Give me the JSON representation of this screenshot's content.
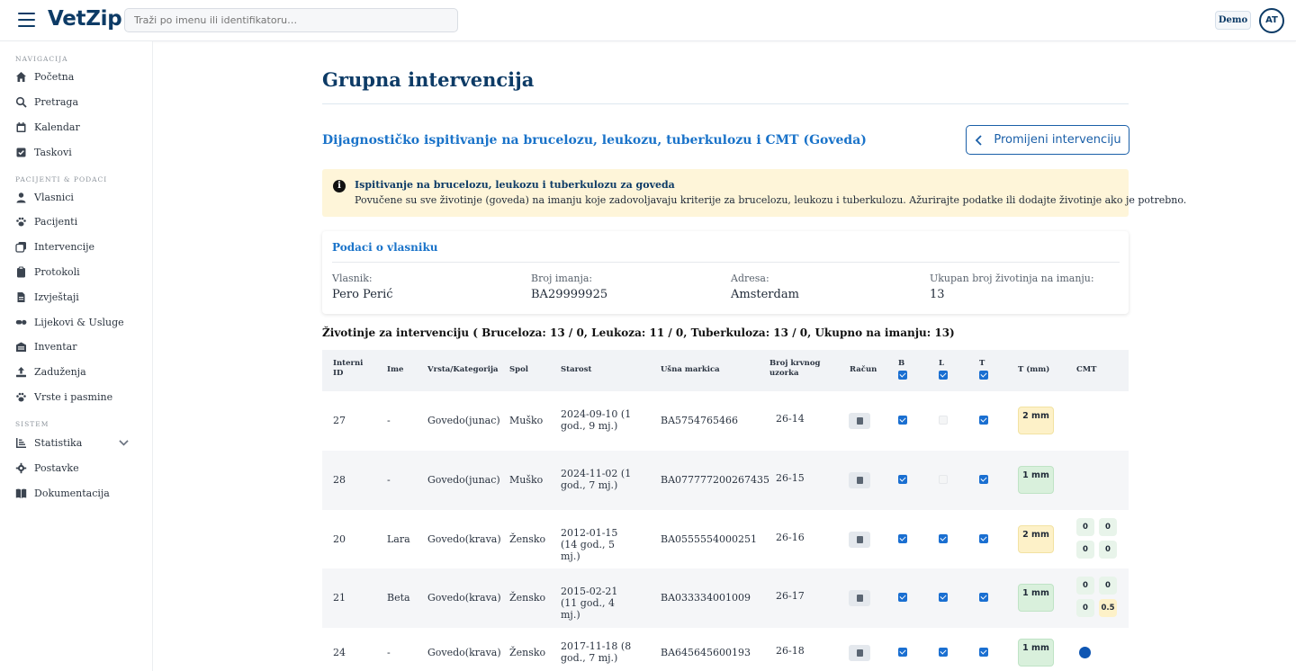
{
  "header": {
    "logo": "VetZip",
    "search_placeholder": "Traži po imenu ili identifikatoru…",
    "demo_badge": "Demo",
    "avatar_initials": "AT"
  },
  "sidebar": {
    "sections": [
      "NAVIGACIJA",
      "PACIJENTI & PODACI",
      "SISTEM"
    ],
    "nav": [
      {
        "label": "Početna",
        "icon": "home-icon"
      },
      {
        "label": "Pretraga",
        "icon": "search-icon"
      },
      {
        "label": "Kalendar",
        "icon": "calendar-icon"
      },
      {
        "label": "Taskovi",
        "icon": "task-icon"
      }
    ],
    "data": [
      {
        "label": "Vlasnici",
        "icon": "person-icon"
      },
      {
        "label": "Pacijenti",
        "icon": "paw-icon"
      },
      {
        "label": "Intervencije",
        "icon": "intervention-icon"
      },
      {
        "label": "Protokoli",
        "icon": "clipboard-icon"
      },
      {
        "label": "Izvještaji",
        "icon": "report-icon"
      },
      {
        "label": "Lijekovi & Usluge",
        "icon": "pills-icon"
      },
      {
        "label": "Inventar",
        "icon": "inventory-icon"
      },
      {
        "label": "Zaduženja",
        "icon": "upload-icon"
      },
      {
        "label": "Vrste i pasmine",
        "icon": "paw-icon"
      }
    ],
    "system": [
      {
        "label": "Statistika",
        "icon": "chart-icon"
      },
      {
        "label": "Postavke",
        "icon": "gear-icon"
      },
      {
        "label": "Dokumentacija",
        "icon": "book-icon"
      }
    ]
  },
  "main": {
    "title": "Grupna intervencija",
    "subtitle": "Dijagnostičko ispitivanje na brucelozu, leukozu, tuberkulozu i CMT (Goveda)",
    "change_button": "Promijeni intervenciju",
    "alert": {
      "title": "Ispitivanje na brucelozu, leukozu i tuberkulozu za goveda",
      "text": "Povučene su sve životinje (goveda) na imanju koje zadovoljavaju kriterije za brucelozu, leukozu i tuberkulozu. Ažurirajte podatke ili dodajte životinje ako je potrebno."
    },
    "owner": {
      "title": "Podaci o vlasniku",
      "fields": [
        {
          "label": "Vlasnik:",
          "value": "Pero Perić"
        },
        {
          "label": "Broj imanja:",
          "value": "BA29999925"
        },
        {
          "label": "Adresa:",
          "value": "Amsterdam"
        },
        {
          "label": "Ukupan broj životinja na imanju:",
          "value": "13"
        }
      ]
    },
    "animals_heading": "Životinje za intervenciju ( Bruceloza: 13 / 0, Leukoza: 11 / 0, Tuberkuloza: 13 / 0, Ukupno na imanju: 13)",
    "table": {
      "columns": [
        "Interni ID",
        "Ime",
        "Vrsta/Kategorija",
        "Spol",
        "Starost",
        "Ušna markica",
        "Broj krvnog uzorka",
        "Račun",
        "B",
        "L",
        "T",
        "T (mm)",
        "CMT"
      ],
      "header_checks": {
        "B": true,
        "L": true,
        "T": true
      },
      "rows": [
        {
          "id": "27",
          "name": "-",
          "species": "Govedo(junac)",
          "sex": "Muško",
          "age": "2024-09-10 (1 god., 9 mj.)",
          "ear_tag": "BA5754765466",
          "sample": "26-14",
          "B": true,
          "L": false,
          "T": true,
          "tmm": "2 mm",
          "tmm_color": "yellow",
          "cmt": null
        },
        {
          "id": "28",
          "name": "-",
          "species": "Govedo(junac)",
          "sex": "Muško",
          "age": "2024-11-02 (1 god., 7 mj.)",
          "ear_tag": "BA077777200267435",
          "sample": "26-15",
          "B": true,
          "L": false,
          "T": true,
          "tmm": "1 mm",
          "tmm_color": "green",
          "cmt": null
        },
        {
          "id": "20",
          "name": "Lara",
          "species": "Govedo(krava)",
          "sex": "Žensko",
          "age": "2012-01-15 (14 god., 5 mj.)",
          "ear_tag": "BA0555554000251",
          "sample": "26-16",
          "B": true,
          "L": true,
          "T": true,
          "tmm": "2 mm",
          "tmm_color": "yellow",
          "cmt": [
            "0",
            "0",
            "0",
            "0"
          ]
        },
        {
          "id": "21",
          "name": "Beta",
          "species": "Govedo(krava)",
          "sex": "Žensko",
          "age": "2015-02-21 (11 god., 4 mj.)",
          "ear_tag": "BA033334001009",
          "sample": "26-17",
          "B": true,
          "L": true,
          "T": true,
          "tmm": "1 mm",
          "tmm_color": "green",
          "cmt": [
            "0",
            "0",
            "0",
            "0.5"
          ]
        },
        {
          "id": "24",
          "name": "-",
          "species": "Govedo(krava)",
          "sex": "Žensko",
          "age": "2017-11-18 (8 god., 7 mj.)",
          "ear_tag": "BA645645600193",
          "sample": "26-18",
          "B": true,
          "L": true,
          "T": true,
          "tmm": "1 mm",
          "tmm_color": "green",
          "cmt": "dot"
        }
      ]
    }
  }
}
